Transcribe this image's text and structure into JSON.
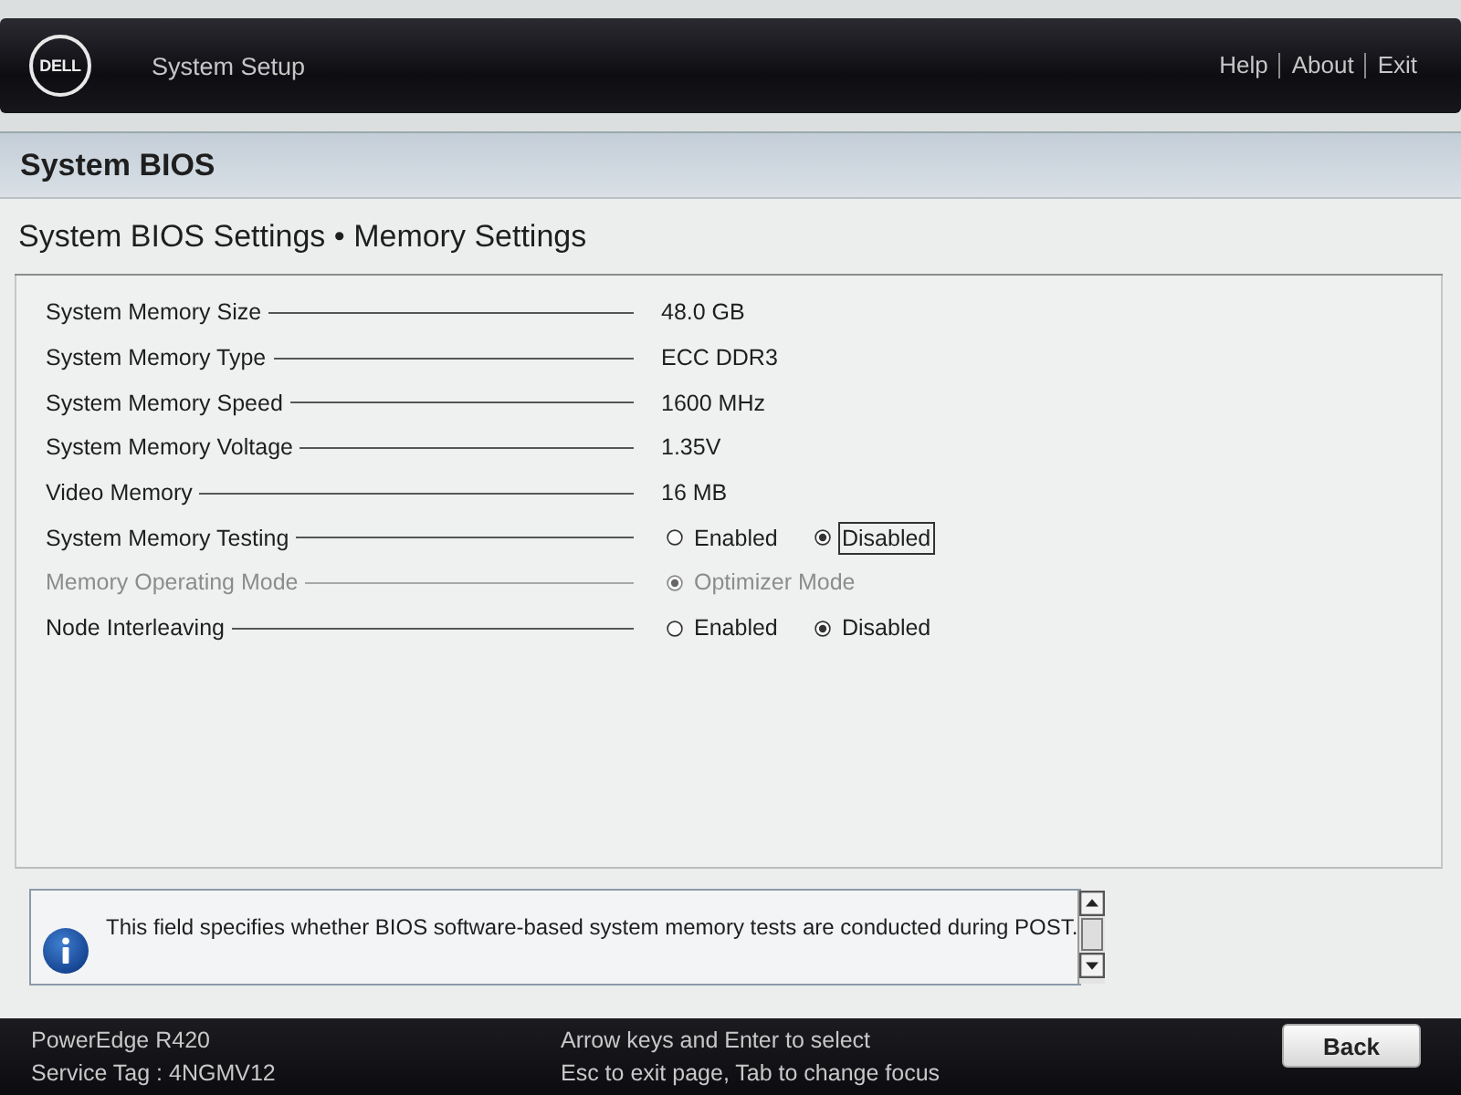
{
  "header": {
    "logo": "DELL",
    "title": "System Setup",
    "links": [
      "Help",
      "About",
      "Exit"
    ]
  },
  "page": {
    "title": "System BIOS",
    "breadcrumb": "System BIOS Settings • Memory Settings"
  },
  "settings": [
    {
      "kind": "value",
      "label": "System Memory Size",
      "disabled": false,
      "value": "48.0 GB"
    },
    {
      "kind": "value",
      "label": "System Memory Type",
      "disabled": false,
      "value": "ECC DDR3"
    },
    {
      "kind": "value",
      "label": "System Memory Speed",
      "disabled": false,
      "value": "1600 MHz"
    },
    {
      "kind": "value",
      "label": "System Memory Voltage",
      "disabled": false,
      "value": "1.35V"
    },
    {
      "kind": "value",
      "label": "Video Memory",
      "disabled": false,
      "value": "16 MB"
    },
    {
      "kind": "radio",
      "label": "System Memory Testing",
      "disabled": false,
      "options": [
        {
          "label": "Enabled",
          "selected": false,
          "focused": false
        },
        {
          "label": "Disabled",
          "selected": true,
          "focused": true
        }
      ]
    },
    {
      "kind": "radio",
      "label": "Memory Operating Mode",
      "disabled": true,
      "options": [
        {
          "label": "Optimizer Mode",
          "selected": true,
          "focused": false
        }
      ]
    },
    {
      "kind": "radio",
      "label": "Node Interleaving",
      "disabled": false,
      "options": [
        {
          "label": "Enabled",
          "selected": false,
          "focused": false
        },
        {
          "label": "Disabled",
          "selected": true,
          "focused": false
        }
      ]
    }
  ],
  "help": {
    "text": "This field specifies whether BIOS software-based system memory tests are conducted during POST."
  },
  "footer": {
    "model": "PowerEdge R420",
    "service_tag": "Service Tag : 4NGMV12",
    "hints": [
      "Arrow keys and Enter to select",
      "Esc to exit page, Tab to change focus"
    ],
    "button": "Back"
  }
}
